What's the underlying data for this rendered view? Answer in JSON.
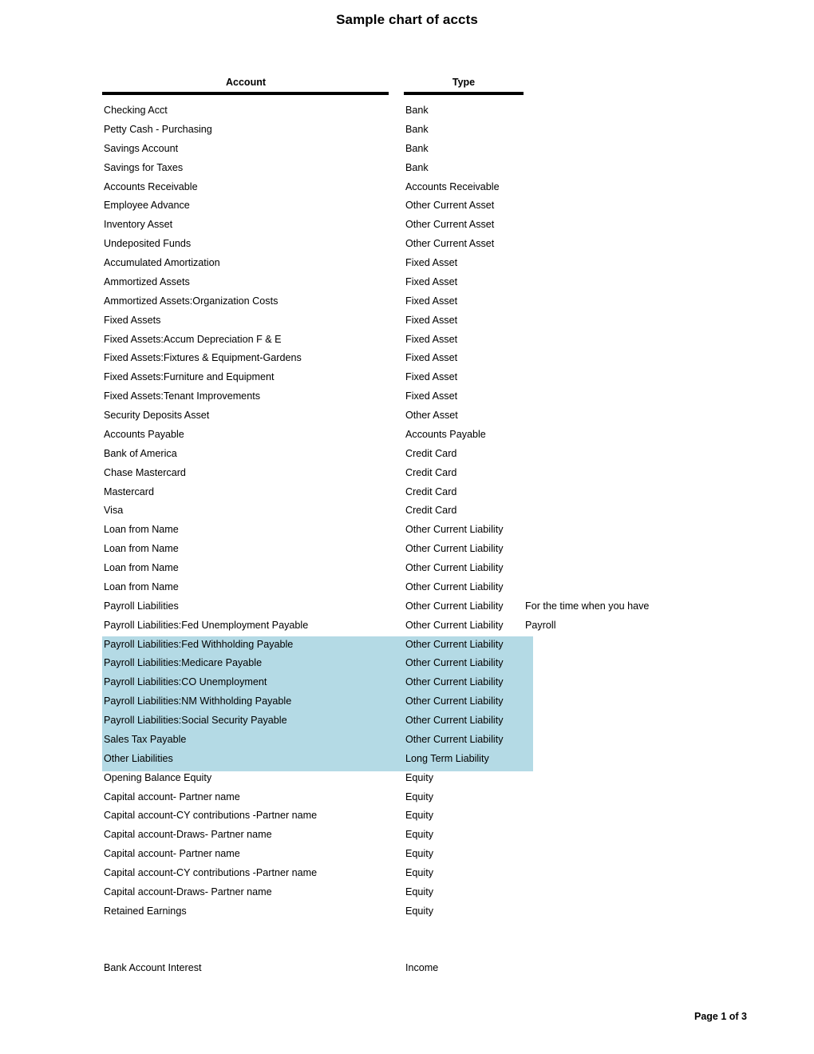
{
  "document": {
    "title": "Sample chart of accts",
    "footer": "Page 1 of 3"
  },
  "table": {
    "columns": {
      "account": "Account",
      "type": "Type",
      "note": ""
    },
    "highlight_color": "#b4dae5",
    "highlight_rows": [
      28,
      29,
      30,
      31,
      32,
      33,
      34
    ],
    "rows": [
      {
        "account": "Checking Acct",
        "type": "Bank",
        "note": ""
      },
      {
        "account": "Petty Cash - Purchasing",
        "type": "Bank",
        "note": ""
      },
      {
        "account": "Savings Account",
        "type": "Bank",
        "note": ""
      },
      {
        "account": "Savings for Taxes",
        "type": "Bank",
        "note": ""
      },
      {
        "account": "Accounts Receivable",
        "type": "Accounts Receivable",
        "note": ""
      },
      {
        "account": "Employee Advance",
        "type": "Other Current Asset",
        "note": ""
      },
      {
        "account": "Inventory Asset",
        "type": "Other Current Asset",
        "note": ""
      },
      {
        "account": "Undeposited Funds",
        "type": "Other Current Asset",
        "note": ""
      },
      {
        "account": "Accumulated Amortization",
        "type": "Fixed Asset",
        "note": ""
      },
      {
        "account": "Ammortized Assets",
        "type": "Fixed Asset",
        "note": ""
      },
      {
        "account": "Ammortized Assets:Organization Costs",
        "type": "Fixed Asset",
        "note": ""
      },
      {
        "account": "Fixed Assets",
        "type": "Fixed Asset",
        "note": ""
      },
      {
        "account": "Fixed Assets:Accum Depreciation F & E",
        "type": "Fixed Asset",
        "note": ""
      },
      {
        "account": "Fixed Assets:Fixtures & Equipment-Gardens",
        "type": "Fixed Asset",
        "note": ""
      },
      {
        "account": "Fixed Assets:Furniture and Equipment",
        "type": "Fixed Asset",
        "note": ""
      },
      {
        "account": "Fixed Assets:Tenant Improvements",
        "type": "Fixed Asset",
        "note": ""
      },
      {
        "account": "Security Deposits Asset",
        "type": "Other Asset",
        "note": ""
      },
      {
        "account": "Accounts Payable",
        "type": "Accounts Payable",
        "note": ""
      },
      {
        "account": "Bank of America",
        "type": "Credit Card",
        "note": ""
      },
      {
        "account": "Chase Mastercard",
        "type": "Credit Card",
        "note": ""
      },
      {
        "account": "Mastercard",
        "type": "Credit Card",
        "note": ""
      },
      {
        "account": "Visa",
        "type": "Credit Card",
        "note": ""
      },
      {
        "account": "Loan from Name",
        "type": "Other Current Liability",
        "note": ""
      },
      {
        "account": "Loan from Name",
        "type": "Other Current Liability",
        "note": ""
      },
      {
        "account": "Loan from Name",
        "type": "Other Current Liability",
        "note": ""
      },
      {
        "account": "Loan from Name",
        "type": "Other Current Liability",
        "note": ""
      },
      {
        "account": "Payroll Liabilities",
        "type": "Other Current Liability",
        "note": "For the time when you have"
      },
      {
        "account": "Payroll Liabilities:Fed Unemployment Payable",
        "type": "Other Current Liability",
        "note": "Payroll"
      },
      {
        "account": "Payroll Liabilities:Fed Withholding Payable",
        "type": "Other Current Liability",
        "note": ""
      },
      {
        "account": "Payroll Liabilities:Medicare Payable",
        "type": "Other Current Liability",
        "note": ""
      },
      {
        "account": "Payroll Liabilities:CO Unemployment",
        "type": "Other Current Liability",
        "note": ""
      },
      {
        "account": "Payroll Liabilities:NM Withholding Payable",
        "type": "Other Current Liability",
        "note": ""
      },
      {
        "account": "Payroll Liabilities:Social Security Payable",
        "type": "Other Current Liability",
        "note": ""
      },
      {
        "account": "Sales Tax Payable",
        "type": "Other Current Liability",
        "note": ""
      },
      {
        "account": "Other Liabilities",
        "type": "Long Term Liability",
        "note": ""
      },
      {
        "account": "Opening Balance Equity",
        "type": "Equity",
        "note": ""
      },
      {
        "account": "Capital account- Partner name",
        "type": "Equity",
        "note": ""
      },
      {
        "account": "Capital account-CY contributions -Partner name",
        "type": "Equity",
        "note": ""
      },
      {
        "account": "Capital account-Draws- Partner name",
        "type": "Equity",
        "note": ""
      },
      {
        "account": "Capital account- Partner name",
        "type": "Equity",
        "note": ""
      },
      {
        "account": "Capital account-CY contributions -Partner name",
        "type": "Equity",
        "note": ""
      },
      {
        "account": "Capital account-Draws- Partner name",
        "type": "Equity",
        "note": ""
      },
      {
        "account": "Retained Earnings",
        "type": "Equity",
        "note": ""
      },
      {
        "account": "",
        "type": "",
        "note": ""
      },
      {
        "account": "",
        "type": "",
        "note": ""
      },
      {
        "account": "Bank Account Interest",
        "type": "Income",
        "note": ""
      }
    ]
  }
}
